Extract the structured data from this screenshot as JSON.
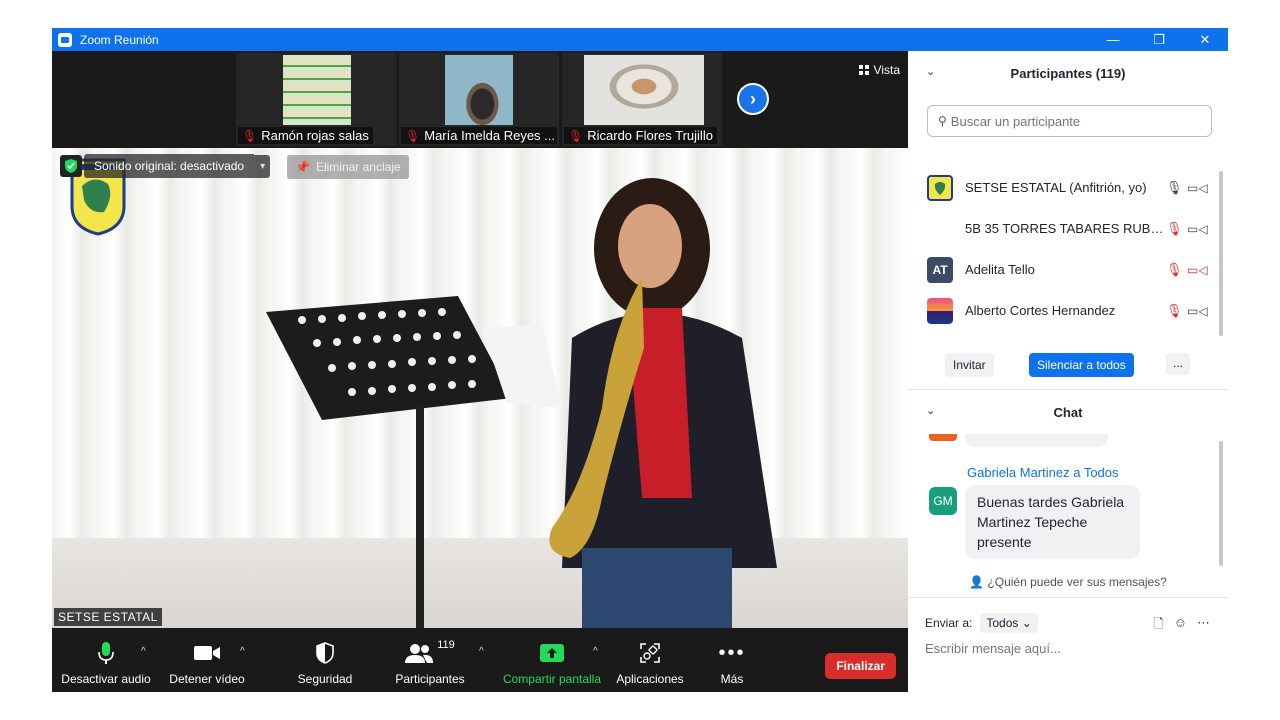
{
  "window": {
    "title": "Zoom Reunión",
    "controls": [
      "—",
      "❐",
      "✕"
    ]
  },
  "thumbnails": [
    {
      "name": "Ramón rojas salas"
    },
    {
      "name": "María Imelda Reyes ..."
    },
    {
      "name": "Ricardo Flores Trujillo"
    }
  ],
  "view_button": {
    "label": "Vista"
  },
  "main_video": {
    "original_sound": "Sonido original: desactivado",
    "unpin": "Eliminar anclaje",
    "speaker": "SETSE ESTATAL"
  },
  "toolbar": {
    "audio": "Desactivar audio",
    "video": "Detener vídeo",
    "security": "Seguridad",
    "participants": "Participantes",
    "participants_count": "119",
    "share": "Compartir pantalla",
    "apps": "Aplicaciones",
    "more": "Más",
    "end": "Finalizar"
  },
  "participants_panel": {
    "title": "Participantes (119)",
    "search_placeholder": "Buscar un participante",
    "rows": [
      {
        "name": "SETSE ESTATAL (Anfitrión, yo)",
        "initials": ""
      },
      {
        "name": "5B 35 TORRES TABARES RUBEN ...",
        "initials": ""
      },
      {
        "name": "Adelita Tello",
        "initials": "AT"
      },
      {
        "name": "Alberto Cortes Hernandez",
        "initials": ""
      }
    ],
    "invite": "Invitar",
    "mute_all": "Silenciar a todos",
    "more": "..."
  },
  "chat_panel": {
    "title": "Chat",
    "message": {
      "from": "Gabriela Martinez a Todos",
      "initials": "GM",
      "text": "Buenas tardes Gabriela Martinez Tepeche presente"
    },
    "who_sees": "¿Quién puede ver sus mensajes?",
    "send_to_label": "Enviar a:",
    "send_to_value": "Todos",
    "input_placeholder": "Escribir mensaje aquí..."
  },
  "colors": {
    "zoom_blue": "#0e72ed",
    "end_red": "#d92d2a",
    "share_green": "#23d959",
    "muted_red": "#e02828",
    "toolbar_bg": "#1a1a1a"
  }
}
